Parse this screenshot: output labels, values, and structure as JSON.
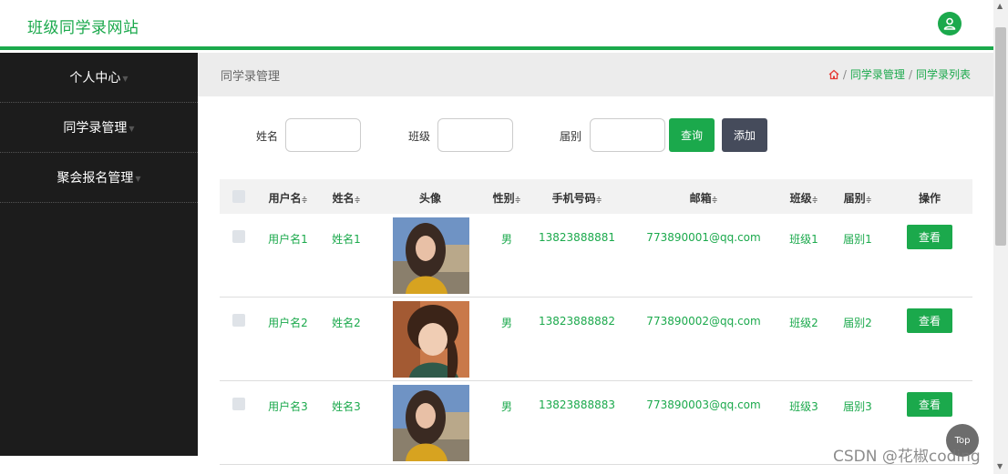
{
  "header": {
    "title": "班级同学录网站",
    "user_icon": "user-icon"
  },
  "sidebar": {
    "items": [
      {
        "label": "个人中心"
      },
      {
        "label": "同学录管理"
      },
      {
        "label": "聚会报名管理"
      }
    ]
  },
  "content": {
    "title": "同学录管理",
    "breadcrumb": {
      "home_icon": "home-icon",
      "sep": "/",
      "level1": "同学录管理",
      "level2": "同学录列表"
    }
  },
  "search": {
    "name_label": "姓名",
    "class_label": "班级",
    "grade_label": "届别",
    "name_value": "",
    "class_value": "",
    "grade_value": "",
    "query_label": "查询",
    "add_label": "添加"
  },
  "table": {
    "headers": {
      "username": "用户名",
      "name": "姓名",
      "avatar": "头像",
      "gender": "性别",
      "phone": "手机号码",
      "email": "邮箱",
      "class": "班级",
      "grade": "届别",
      "action": "操作"
    },
    "sort_icon": "≑",
    "rows": [
      {
        "username": "用户名1",
        "name": "姓名1",
        "gender": "男",
        "phone": "13823888881",
        "email": "773890001@qq.com",
        "class": "班级1",
        "grade": "届别1",
        "action": "查看"
      },
      {
        "username": "用户名2",
        "name": "姓名2",
        "gender": "男",
        "phone": "13823888882",
        "email": "773890002@qq.com",
        "class": "班级2",
        "grade": "届别2",
        "action": "查看"
      },
      {
        "username": "用户名3",
        "name": "姓名3",
        "gender": "男",
        "phone": "13823888883",
        "email": "773890003@qq.com",
        "class": "班级3",
        "grade": "届别3",
        "action": "查看"
      }
    ]
  },
  "top_button": "Top",
  "watermark": "CSDN @花椒coding",
  "colors": {
    "accent": "#1ba94c",
    "sidebar": "#1c1c1c",
    "add_button": "#454b5b"
  }
}
